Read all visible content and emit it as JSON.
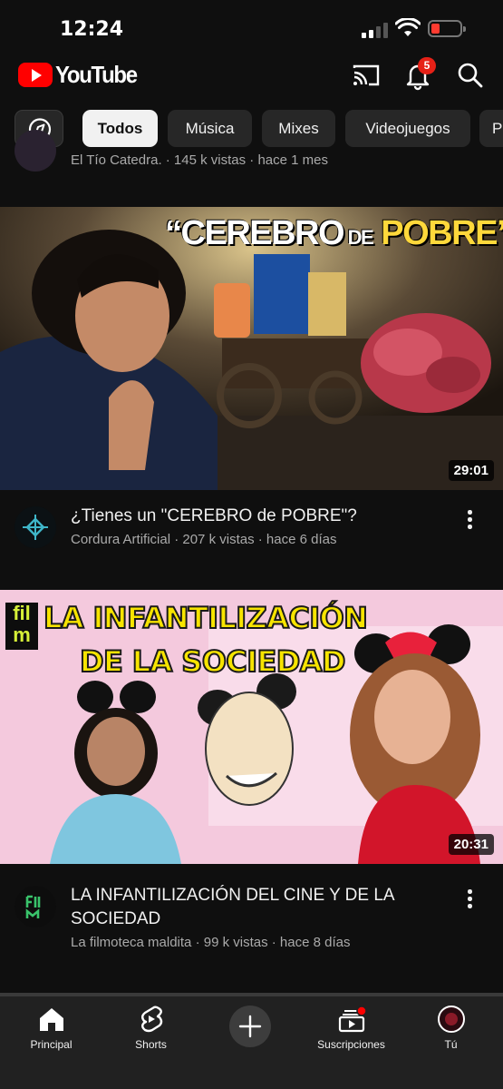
{
  "status": {
    "time": "12:24"
  },
  "header": {
    "logo_text": "YouTube",
    "notification_count": "5"
  },
  "chips": [
    "Todos",
    "Música",
    "Mixes",
    "Videojuegos",
    "P"
  ],
  "previous_video": {
    "meta": "El Tío Catedra. · 145 k vistas · hace 1 mes"
  },
  "videos": [
    {
      "thumbnail_text": "“CEREBRO DE POBRE”",
      "duration": "29:01",
      "title": "¿Tienes un \"CEREBRO de POBRE\"?",
      "channel_meta": "Cordura Artificial · 207 k vistas · hace 6 días"
    },
    {
      "thumbnail_text": "LA INFANTILIZACIÓN DE LA SOCIEDAD",
      "thumbnail_line1": "LA INFANTILIZACIÓN",
      "thumbnail_line2": "DE LA SOCIEDAD",
      "thumbnail_logo": "fil m",
      "duration": "20:31",
      "title": "LA INFANTILIZACIÓN DEL CINE Y DE LA SOCIEDAD",
      "channel_meta": "La filmoteca maldita · 99 k vistas · hace 8 días"
    }
  ],
  "tabbar": {
    "items": [
      {
        "label": "Principal",
        "icon": "home-icon"
      },
      {
        "label": "Shorts",
        "icon": "shorts-icon"
      },
      {
        "label": "",
        "icon": "create-icon"
      },
      {
        "label": "Suscripciones",
        "icon": "subscriptions-icon"
      },
      {
        "label": "Tú",
        "icon": "profile-icon"
      }
    ]
  },
  "colors": {
    "background": "#0f0f0f",
    "brand_red": "#ff0000",
    "chip_bg": "#272727",
    "chip_active_bg": "#f1f1f1",
    "thumb2_title_yellow": "#f7e400"
  }
}
